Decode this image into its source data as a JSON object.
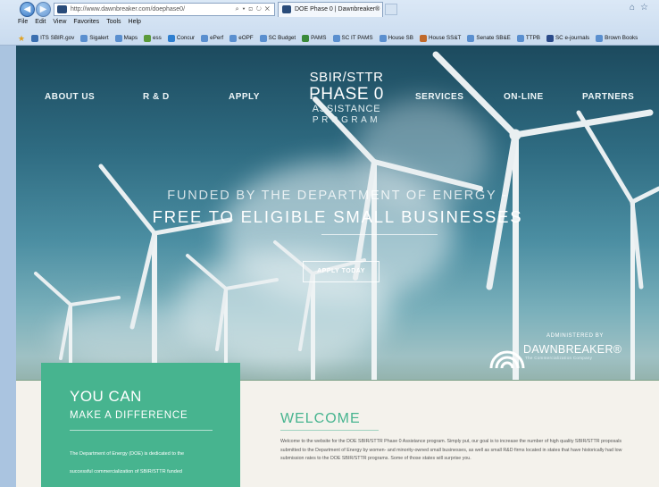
{
  "browser": {
    "address": "http://www.dawnbreaker.com/doephase0/",
    "address_host": "dawnbreaker.com",
    "address_icons": "⌕ ▾ ⊡ ↻ ✕",
    "tab_title": "DOE Phase 0 | Dawnbreaker®",
    "menu": [
      "File",
      "Edit",
      "View",
      "Favorites",
      "Tools",
      "Help"
    ],
    "favorites": [
      {
        "label": "ITS SBIR.gov",
        "color": "#3a6fb0"
      },
      {
        "label": "Sigalert",
        "color": "#5a8fcf"
      },
      {
        "label": "Maps",
        "color": "#5a8fcf"
      },
      {
        "label": "ess",
        "color": "#5a9a3a"
      },
      {
        "label": "Concur",
        "color": "#2e7fd0"
      },
      {
        "label": "ePerf",
        "color": "#5a8fcf"
      },
      {
        "label": "eOPF",
        "color": "#5a8fcf"
      },
      {
        "label": "SC Budget",
        "color": "#5a8fcf"
      },
      {
        "label": "PAMS",
        "color": "#3a8a3a"
      },
      {
        "label": "SC IT PAMS",
        "color": "#5a8fcf"
      },
      {
        "label": "House SB",
        "color": "#5a8fcf"
      },
      {
        "label": "House SS&T",
        "color": "#c0692a"
      },
      {
        "label": "Senate SB&E",
        "color": "#5a8fcf"
      },
      {
        "label": "TTPB",
        "color": "#5a8fcf"
      },
      {
        "label": "SC e-journals",
        "color": "#2a4a8a"
      },
      {
        "label": "Brown Books",
        "color": "#5a8fcf"
      }
    ]
  },
  "nav": {
    "about": "ABOUT US",
    "rd": "R & D",
    "apply": "APPLY",
    "services": "SERVICES",
    "online": "ON-LINE",
    "partners": "PARTNERS"
  },
  "logo": {
    "line1": "SBIR/STTR",
    "line2": "PHASE 0",
    "line3": "ASSISTANCE",
    "line4": "PROGRAM"
  },
  "hero": {
    "tagline1": "FUNDED BY THE DEPARTMENT OF ENERGY -",
    "tagline2": "FREE TO ELIGIBLE SMALL BUSINESSES",
    "apply_button": "APPLY TODAY",
    "administered": "ADMINISTERED BY",
    "company": "DAWNBREAKER®",
    "company_sub": "The Commercialization Company"
  },
  "card": {
    "heading": "YOU CAN",
    "subheading": "MAKE A DIFFERENCE",
    "text1": "The Department of Energy (DOE) is dedicated to the",
    "text2": "successful commercialization of SBIR/STTR funded"
  },
  "welcome": {
    "heading": "WELCOME",
    "text": "Welcome to the website for the DOE SBIR/STTR Phase 0 Assistance program. Simply put, our goal is to increase the number of high quality SBIR/STTR proposals submitted to the Department of Energy by women- and minority-owned small businesses, as well as small R&D firms located in states that have historically had low submission rates to the DOE SBIR/STTR programs. Some of those states will surprise you."
  }
}
